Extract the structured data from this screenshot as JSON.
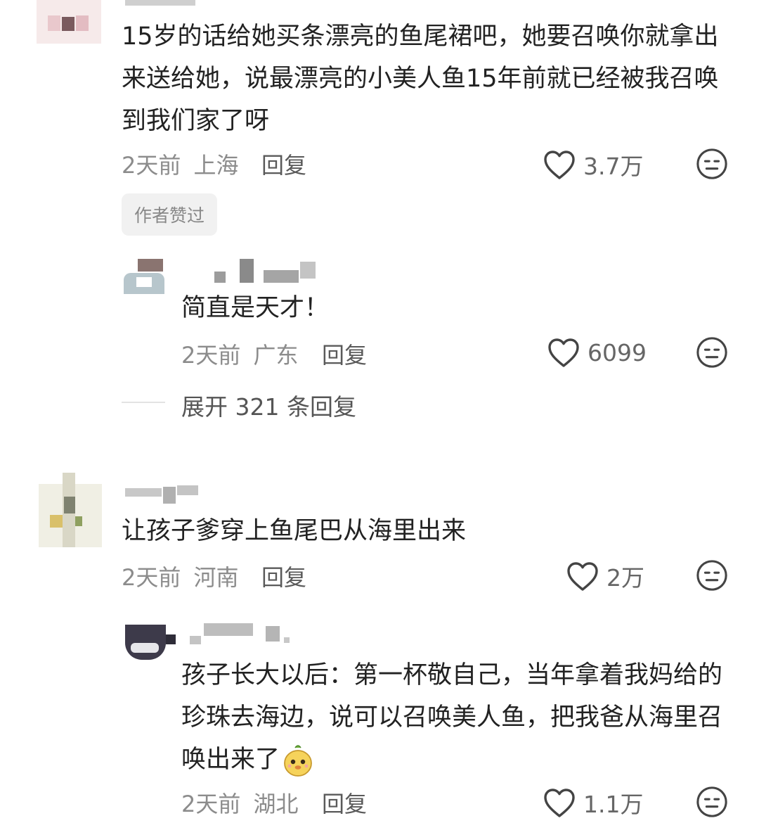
{
  "comments": [
    {
      "text": "15岁的话给她买条漂亮的鱼尾裙吧，她要召唤你就拿出来送给她，说最漂亮的小美人鱼15年前就已经被我召唤到我们家了呀",
      "time": "2天前",
      "location": "上海",
      "reply_label": "回复",
      "likes": "3.7万",
      "author_badge": "作者赞过",
      "reply": {
        "text": "简直是天才！",
        "time": "2天前",
        "location": "广东",
        "reply_label": "回复",
        "likes": "6099"
      },
      "expand_label": "展开 321 条回复"
    },
    {
      "text": "让孩子爹穿上鱼尾巴从海里出来",
      "time": "2天前",
      "location": "河南",
      "reply_label": "回复",
      "likes": "2万",
      "reply": {
        "text": "孩子长大以后：第一杯敬自己，当年拿着我妈给的珍珠去海边，说可以召唤美人鱼，把我爸从海里召唤出来了",
        "emoji": "mascot-emoji",
        "time": "2天前",
        "location": "湖北",
        "reply_label": "回复",
        "likes": "1.1万"
      }
    }
  ],
  "icons": {
    "like": "heart-outline-icon",
    "dislike": "neutral-face-icon"
  },
  "colors": {
    "text": "#222222",
    "meta": "#8c8c8c",
    "badge_bg": "#f1f1f1"
  }
}
